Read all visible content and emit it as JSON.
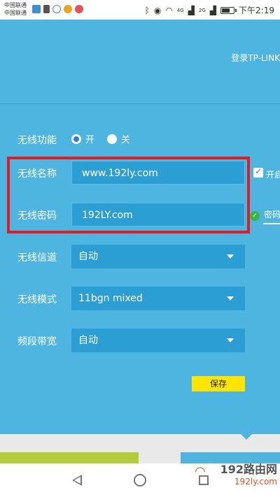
{
  "status_bar": {
    "carrier_line1": "中国联通",
    "carrier_line2": "中国联通",
    "icons_left": [
      "message-icon",
      "sd-card-icon",
      "notification-icon",
      "weibo-icon",
      "weibo-icon"
    ],
    "network_label": "4G",
    "network_label_2": "2G",
    "time": "下午2:19",
    "battery_level": 0.7
  },
  "header": {
    "login_link": "登录TP-LINK"
  },
  "wireless": {
    "function_label": "无线功能",
    "on_label": "开",
    "off_label": "关",
    "selected": "开",
    "name_label": "无线名称",
    "name_value": "www.192ly.com",
    "password_label": "无线密码",
    "password_value": "192LY.com",
    "channel_label": "无线信道",
    "channel_value": "自动",
    "mode_label": "无线模式",
    "mode_value": "11bgn mixed",
    "bandwidth_label": "频段带宽",
    "bandwidth_value": "自动",
    "side_open_label": "开启",
    "side_password_label": "密码",
    "save_label": "保存"
  },
  "watermark": {
    "big": "192路由网",
    "small": "192ly.com"
  },
  "colors": {
    "panel": "#4db5e0",
    "field": "#2b9ed3",
    "highlight": "#e31b23",
    "save": "#ffe600",
    "green_bar": "#b5cc3a"
  }
}
